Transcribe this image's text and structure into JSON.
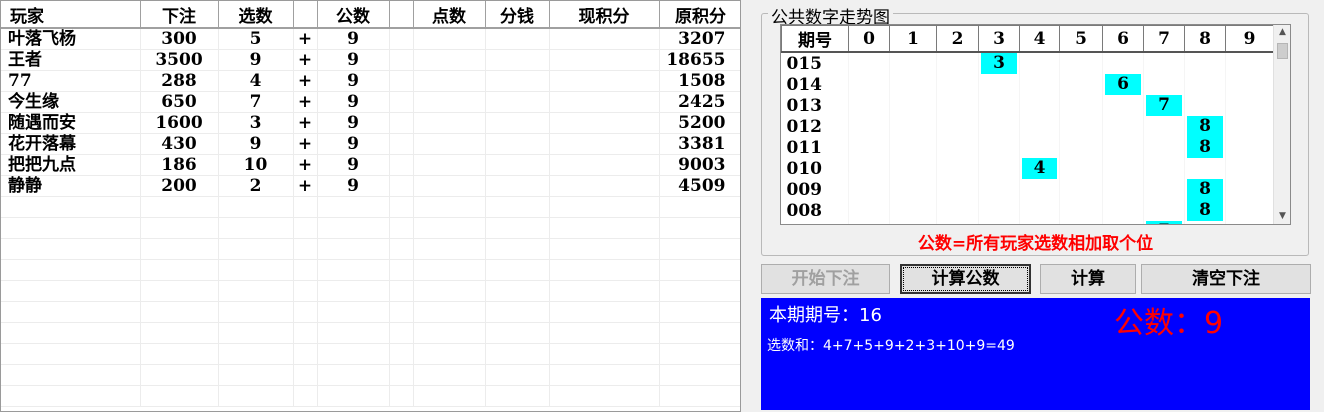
{
  "player_table": {
    "headers": [
      "玩家",
      "下注",
      "选数",
      "",
      "公数",
      "",
      "点数",
      "分钱",
      "现积分",
      "原积分"
    ],
    "rows": [
      {
        "name": "叶落飞杨",
        "bet": "300",
        "pick": "5",
        "op": "+",
        "pub": "9",
        "orig": "3207"
      },
      {
        "name": "王者",
        "bet": "3500",
        "pick": "9",
        "op": "+",
        "pub": "9",
        "orig": "18655"
      },
      {
        "name": "77",
        "bet": "288",
        "pick": "4",
        "op": "+",
        "pub": "9",
        "orig": "1508"
      },
      {
        "name": "今生缘",
        "bet": "650",
        "pick": "7",
        "op": "+",
        "pub": "9",
        "orig": "2425"
      },
      {
        "name": "随遇而安",
        "bet": "1600",
        "pick": "3",
        "op": "+",
        "pub": "9",
        "orig": "5200"
      },
      {
        "name": "花开落幕",
        "bet": "430",
        "pick": "9",
        "op": "+",
        "pub": "9",
        "orig": "3381"
      },
      {
        "name": "把把九点",
        "bet": "186",
        "pick": "10",
        "op": "+",
        "pub": "9",
        "orig": "9003"
      },
      {
        "name": "静静",
        "bet": "200",
        "pick": "2",
        "op": "+",
        "pub": "9",
        "orig": "4509"
      }
    ]
  },
  "trend": {
    "title": "公共数字走势图",
    "headers": [
      "期号",
      "0",
      "1",
      "2",
      "3",
      "4",
      "5",
      "6",
      "7",
      "8",
      "9"
    ],
    "rows": [
      {
        "period": "015",
        "value": 3
      },
      {
        "period": "014",
        "value": 6
      },
      {
        "period": "013",
        "value": 7
      },
      {
        "period": "012",
        "value": 8
      },
      {
        "period": "011",
        "value": 8
      },
      {
        "period": "010",
        "value": 4
      },
      {
        "period": "009",
        "value": 8
      },
      {
        "period": "008",
        "value": 8
      },
      {
        "period": "",
        "value": 7
      }
    ],
    "highlight_color": "#00ffff",
    "rule": "公数=所有玩家选数相加取个位"
  },
  "buttons": {
    "start": "开始下注",
    "calc_public": "计算公数",
    "calc": "计算",
    "clear": "清空下注"
  },
  "output": {
    "period_label": "本期期号：16",
    "public_label": "公数：9",
    "sum_line": "选数和：4+7+5+9+2+3+10+9=49",
    "bg_color": "#0000ff",
    "public_color": "#ff0000"
  }
}
